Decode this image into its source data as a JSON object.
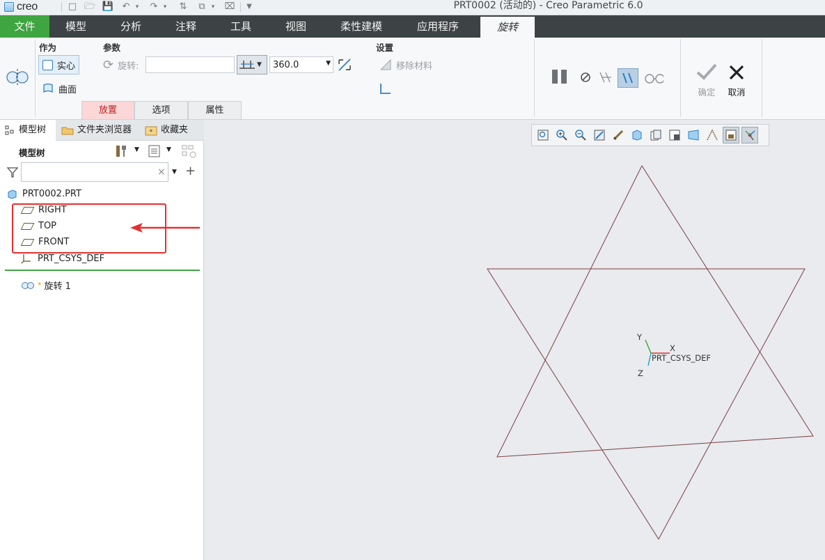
{
  "app": {
    "logo_text": "creo",
    "title": "PRT0002 (活动的) - Creo Parametric 6.0"
  },
  "menu": {
    "tabs": [
      {
        "label": "文件"
      },
      {
        "label": "模型"
      },
      {
        "label": "分析"
      },
      {
        "label": "注释"
      },
      {
        "label": "工具"
      },
      {
        "label": "视图"
      },
      {
        "label": "柔性建模"
      },
      {
        "label": "应用程序"
      },
      {
        "label": "旋转"
      }
    ]
  },
  "ribbon": {
    "as_group": {
      "title": "作为",
      "solid": "实心",
      "surface": "曲面"
    },
    "params_group": {
      "title": "参数",
      "rotate_label": "旋转:",
      "angle_value": "360.0"
    },
    "settings_group": {
      "title": "设置",
      "remove_material": "移除材料"
    },
    "ok_label": "确定",
    "cancel_label": "取消",
    "subtabs": [
      {
        "label": "放置"
      },
      {
        "label": "选项"
      },
      {
        "label": "属性"
      }
    ]
  },
  "left_panel": {
    "tabs": [
      {
        "label": "模型树"
      },
      {
        "label": "文件夹浏览器"
      },
      {
        "label": "收藏夹"
      }
    ],
    "tree_title": "模型树",
    "filter_placeholder": "",
    "root": "PRT0002.PRT",
    "datum_planes": [
      "RIGHT",
      "TOP",
      "FRONT"
    ],
    "csys": "PRT_CSYS_DEF",
    "feature": "旋转 1",
    "feature_marker": "*"
  },
  "graphics": {
    "csys_label": "PRT_CSYS_DEF",
    "axis_labels": {
      "x": "X",
      "y": "Y",
      "z": "Z"
    }
  },
  "colors": {
    "file_tab": "#3fa540",
    "menubar": "#3d4245",
    "highlight": "#e53030",
    "plane_edges": "#7a3f45"
  }
}
